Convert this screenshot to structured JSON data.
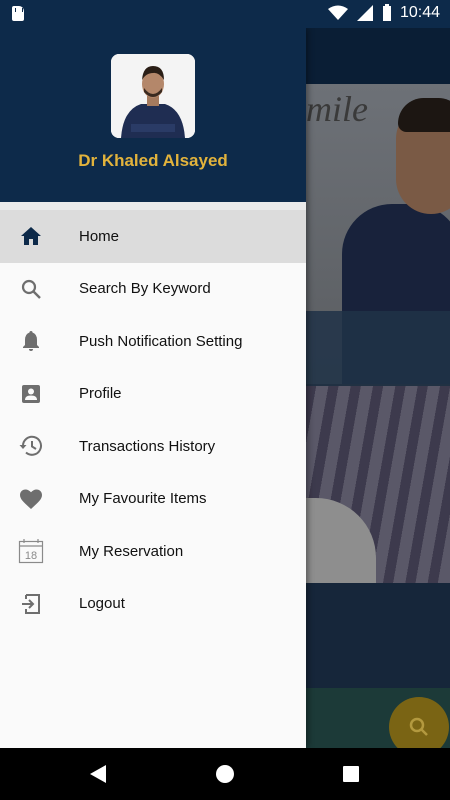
{
  "status_bar": {
    "time": "10:44"
  },
  "drawer": {
    "user_name": "Dr Khaled Alsayed",
    "menu_items": [
      {
        "label": "Home",
        "icon": "home-icon",
        "active": true
      },
      {
        "label": "Search By Keyword",
        "icon": "search-icon",
        "active": false
      },
      {
        "label": "Push Notification Setting",
        "icon": "bell-icon",
        "active": false
      },
      {
        "label": "Profile",
        "icon": "profile-card-icon",
        "active": false
      },
      {
        "label": "Transactions History",
        "icon": "history-icon",
        "active": false
      },
      {
        "label": "My Favourite Items",
        "icon": "heart-icon",
        "active": false
      },
      {
        "label": "My Reservation",
        "icon": "calendar-icon",
        "calendar_day": "18",
        "active": false
      },
      {
        "label": "Logout",
        "icon": "logout-icon",
        "active": false
      }
    ]
  },
  "background": {
    "hero_text": "mile"
  },
  "colors": {
    "header": "#0d2a4a",
    "accent": "#e2b33c",
    "active_row": "#dcdcdc",
    "fab": "#7a6414"
  }
}
